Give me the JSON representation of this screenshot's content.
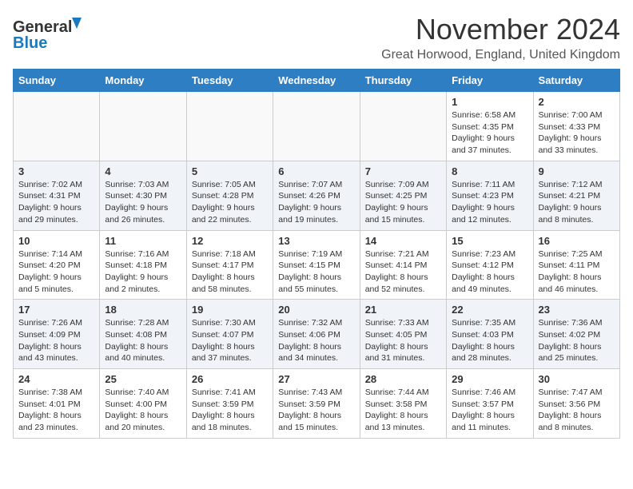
{
  "logo": {
    "line1": "General",
    "line2": "Blue"
  },
  "title": "November 2024",
  "subtitle": "Great Horwood, England, United Kingdom",
  "headers": [
    "Sunday",
    "Monday",
    "Tuesday",
    "Wednesday",
    "Thursday",
    "Friday",
    "Saturday"
  ],
  "rows": [
    [
      {
        "day": "",
        "info": ""
      },
      {
        "day": "",
        "info": ""
      },
      {
        "day": "",
        "info": ""
      },
      {
        "day": "",
        "info": ""
      },
      {
        "day": "",
        "info": ""
      },
      {
        "day": "1",
        "info": "Sunrise: 6:58 AM\nSunset: 4:35 PM\nDaylight: 9 hours and 37 minutes."
      },
      {
        "day": "2",
        "info": "Sunrise: 7:00 AM\nSunset: 4:33 PM\nDaylight: 9 hours and 33 minutes."
      }
    ],
    [
      {
        "day": "3",
        "info": "Sunrise: 7:02 AM\nSunset: 4:31 PM\nDaylight: 9 hours and 29 minutes."
      },
      {
        "day": "4",
        "info": "Sunrise: 7:03 AM\nSunset: 4:30 PM\nDaylight: 9 hours and 26 minutes."
      },
      {
        "day": "5",
        "info": "Sunrise: 7:05 AM\nSunset: 4:28 PM\nDaylight: 9 hours and 22 minutes."
      },
      {
        "day": "6",
        "info": "Sunrise: 7:07 AM\nSunset: 4:26 PM\nDaylight: 9 hours and 19 minutes."
      },
      {
        "day": "7",
        "info": "Sunrise: 7:09 AM\nSunset: 4:25 PM\nDaylight: 9 hours and 15 minutes."
      },
      {
        "day": "8",
        "info": "Sunrise: 7:11 AM\nSunset: 4:23 PM\nDaylight: 9 hours and 12 minutes."
      },
      {
        "day": "9",
        "info": "Sunrise: 7:12 AM\nSunset: 4:21 PM\nDaylight: 9 hours and 8 minutes."
      }
    ],
    [
      {
        "day": "10",
        "info": "Sunrise: 7:14 AM\nSunset: 4:20 PM\nDaylight: 9 hours and 5 minutes."
      },
      {
        "day": "11",
        "info": "Sunrise: 7:16 AM\nSunset: 4:18 PM\nDaylight: 9 hours and 2 minutes."
      },
      {
        "day": "12",
        "info": "Sunrise: 7:18 AM\nSunset: 4:17 PM\nDaylight: 8 hours and 58 minutes."
      },
      {
        "day": "13",
        "info": "Sunrise: 7:19 AM\nSunset: 4:15 PM\nDaylight: 8 hours and 55 minutes."
      },
      {
        "day": "14",
        "info": "Sunrise: 7:21 AM\nSunset: 4:14 PM\nDaylight: 8 hours and 52 minutes."
      },
      {
        "day": "15",
        "info": "Sunrise: 7:23 AM\nSunset: 4:12 PM\nDaylight: 8 hours and 49 minutes."
      },
      {
        "day": "16",
        "info": "Sunrise: 7:25 AM\nSunset: 4:11 PM\nDaylight: 8 hours and 46 minutes."
      }
    ],
    [
      {
        "day": "17",
        "info": "Sunrise: 7:26 AM\nSunset: 4:09 PM\nDaylight: 8 hours and 43 minutes."
      },
      {
        "day": "18",
        "info": "Sunrise: 7:28 AM\nSunset: 4:08 PM\nDaylight: 8 hours and 40 minutes."
      },
      {
        "day": "19",
        "info": "Sunrise: 7:30 AM\nSunset: 4:07 PM\nDaylight: 8 hours and 37 minutes."
      },
      {
        "day": "20",
        "info": "Sunrise: 7:32 AM\nSunset: 4:06 PM\nDaylight: 8 hours and 34 minutes."
      },
      {
        "day": "21",
        "info": "Sunrise: 7:33 AM\nSunset: 4:05 PM\nDaylight: 8 hours and 31 minutes."
      },
      {
        "day": "22",
        "info": "Sunrise: 7:35 AM\nSunset: 4:03 PM\nDaylight: 8 hours and 28 minutes."
      },
      {
        "day": "23",
        "info": "Sunrise: 7:36 AM\nSunset: 4:02 PM\nDaylight: 8 hours and 25 minutes."
      }
    ],
    [
      {
        "day": "24",
        "info": "Sunrise: 7:38 AM\nSunset: 4:01 PM\nDaylight: 8 hours and 23 minutes."
      },
      {
        "day": "25",
        "info": "Sunrise: 7:40 AM\nSunset: 4:00 PM\nDaylight: 8 hours and 20 minutes."
      },
      {
        "day": "26",
        "info": "Sunrise: 7:41 AM\nSunset: 3:59 PM\nDaylight: 8 hours and 18 minutes."
      },
      {
        "day": "27",
        "info": "Sunrise: 7:43 AM\nSunset: 3:59 PM\nDaylight: 8 hours and 15 minutes."
      },
      {
        "day": "28",
        "info": "Sunrise: 7:44 AM\nSunset: 3:58 PM\nDaylight: 8 hours and 13 minutes."
      },
      {
        "day": "29",
        "info": "Sunrise: 7:46 AM\nSunset: 3:57 PM\nDaylight: 8 hours and 11 minutes."
      },
      {
        "day": "30",
        "info": "Sunrise: 7:47 AM\nSunset: 3:56 PM\nDaylight: 8 hours and 8 minutes."
      }
    ]
  ]
}
